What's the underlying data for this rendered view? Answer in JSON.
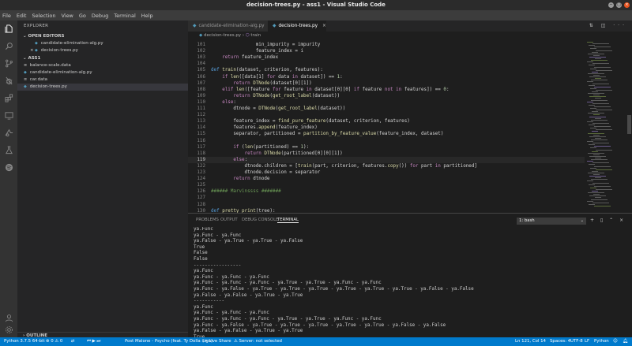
{
  "window": {
    "title": "decision-trees.py - ass1 - Visual Studio Code",
    "controls": [
      "−",
      "□",
      "×"
    ]
  },
  "menu": [
    "File",
    "Edit",
    "Selection",
    "View",
    "Go",
    "Debug",
    "Terminal",
    "Help"
  ],
  "activity_icons": [
    "files-icon",
    "search-icon",
    "source-control-icon",
    "debug-icon",
    "extensions-icon",
    "remote-icon",
    "live-share-icon",
    "test-icon",
    "spotify-icon"
  ],
  "sidebar": {
    "title": "EXPLORER",
    "open_editors_label": "OPEN EDITORS",
    "open_editors": [
      {
        "name": "candidate-elimination-alg.py",
        "close": ""
      },
      {
        "name": "decision-trees.py",
        "close": "×"
      }
    ],
    "folder_label": "ASS1",
    "files": [
      {
        "name": "balance-scale.data",
        "icon": "≡"
      },
      {
        "name": "candidate-elimination-alg.py",
        "icon": "◆"
      },
      {
        "name": "car.data",
        "icon": "≡"
      },
      {
        "name": "decision-trees.py",
        "icon": "◆"
      }
    ],
    "outline_label": "OUTLINE"
  },
  "tabs": [
    {
      "label": "candidate-elimination-alg.py",
      "active": false
    },
    {
      "label": "decision-trees.py",
      "active": true,
      "close": "×"
    }
  ],
  "tab_actions": "⇅ ◫ ···",
  "breadcrumb": [
    "decision-trees.py",
    "train"
  ],
  "code_lines": [
    {
      "n": "101",
      "html": "<span class='tx'>                min_impurity = impurity</span>"
    },
    {
      "n": "102",
      "html": "<span class='tx'>                feature_index = i</span>"
    },
    {
      "n": "103",
      "html": "<span class='tx'>    </span><span class='ct'>return</span><span class='tx'> feature_index</span>"
    },
    {
      "n": "104",
      "html": ""
    },
    {
      "n": "105",
      "html": "<span class='kw'>def</span><span class='tx'> </span><span class='fn'>train</span><span class='tx'>(dataset, criterion, features):</span>"
    },
    {
      "n": "106",
      "html": "<span class='tx'>    </span><span class='ct'>if</span><span class='tx'> </span><span class='fn'>len</span><span class='tx'>([data[1] </span><span class='ct'>for</span><span class='tx'> data </span><span class='ct'>in</span><span class='tx'> dataset]) == </span><span class='nm'>1</span><span class='tx'>:</span>"
    },
    {
      "n": "107",
      "html": "<span class='tx'>        </span><span class='ct'>return</span><span class='tx'> </span><span class='fn'>DTNode</span><span class='tx'>(dataset[0][1])</span>"
    },
    {
      "n": "108",
      "html": "<span class='tx'>    </span><span class='ct'>elif</span><span class='tx'> </span><span class='fn'>len</span><span class='tx'>([feature </span><span class='ct'>for</span><span class='tx'> feature </span><span class='ct'>in</span><span class='tx'> dataset[0][0] </span><span class='ct'>if</span><span class='tx'> feature </span><span class='ct'>not in</span><span class='tx'> features]) == </span><span class='nm'>0</span><span class='tx'>:</span>"
    },
    {
      "n": "109",
      "html": "<span class='tx'>        </span><span class='ct'>return</span><span class='tx'> </span><span class='fn'>DTNode</span><span class='tx'>(</span><span class='fn'>get_root_label</span><span class='tx'>(dataset))</span>"
    },
    {
      "n": "110",
      "html": "<span class='tx'>    </span><span class='ct'>else</span><span class='tx'>:</span>"
    },
    {
      "n": "111",
      "html": "<span class='tx'>        dtnode = </span><span class='fn'>DTNode</span><span class='tx'>(</span><span class='fn'>get_root_label</span><span class='tx'>(dataset))</span>"
    },
    {
      "n": "112",
      "html": ""
    },
    {
      "n": "113",
      "html": "<span class='tx'>        feature_index = </span><span class='fn'>find_pure_feature</span><span class='tx'>(dataset, criterion, features)</span>"
    },
    {
      "n": "114",
      "html": "<span class='tx'>        features.</span><span class='fn'>append</span><span class='tx'>(feature_index)</span>"
    },
    {
      "n": "115",
      "html": "<span class='tx'>        separator, partitioned = </span><span class='fn'>partition_by_feature_value</span><span class='tx'>(feature_index, dataset)</span>"
    },
    {
      "n": "116",
      "html": ""
    },
    {
      "n": "117",
      "html": "<span class='tx'>        </span><span class='ct'>if</span><span class='tx'> (</span><span class='fn'>len</span><span class='tx'>(partitioned) == </span><span class='nm'>1</span><span class='tx'>):</span>"
    },
    {
      "n": "118",
      "html": "<span class='tx'>            </span><span class='ct'>return</span><span class='tx'> </span><span class='fn'>DTNode</span><span class='tx'>(partitioned[0][0][1])</span>"
    },
    {
      "n": "119",
      "html": "<span class='tx'>        </span><span class='ct'>else</span><span class='tx'>:</span>",
      "current": true
    },
    {
      "n": "122",
      "html": "<span class='tx'>            dtnode.children = [</span><span class='fn'>train</span><span class='tx'>(part, criterion, features.</span><span class='fn'>copy</span><span class='tx'>()) </span><span class='ct'>for</span><span class='tx'> part </span><span class='ct'>in</span><span class='tx'> partitioned]</span>"
    },
    {
      "n": "123",
      "html": "<span class='tx'>            dtnode.decision = separator</span>"
    },
    {
      "n": "124",
      "html": "<span class='tx'>        </span><span class='ct'>return</span><span class='tx'> dtnode</span>"
    },
    {
      "n": "125",
      "html": ""
    },
    {
      "n": "126",
      "html": "<span class='cm'>###### Marvinssss #######</span>"
    },
    {
      "n": "127",
      "html": ""
    },
    {
      "n": "128",
      "html": ""
    },
    {
      "n": "130",
      "html": "<span class='kw'>def</span><span class='tx'> </span><span class='fn'>pretty_print</span><span class='tx'>(tree):</span>"
    }
  ],
  "panel": {
    "tabs": [
      "PROBLEMS",
      "OUTPUT",
      "DEBUG CONSOLE",
      "TERMINAL"
    ],
    "active_tab": "TERMINAL",
    "terminal_select": "1: bash",
    "actions": "+ ▯ ⌃ ×"
  },
  "terminal_lines": [
    "ya.Func",
    "ya.Func - ya.Func",
    "ya.False - ya.True - ya.True - ya.False",
    "True",
    "False",
    "False",
    "-----------------",
    "ya.Func",
    "ya.Func - ya.Func - ya.Func",
    "ya.Func - ya.Func - ya.Func - ya.True - ya.True - ya.Func - ya.Func",
    "ya.Func - ya.False - ya.True - ya.True - ya.True - ya.True - ya.True - ya.True - ya.False - ya.False",
    "ya.False - ya.False - ya.True - ya.True",
    "-----------",
    "ya.Func",
    "ya.Func - ya.Func - ya.Func",
    "ya.Func - ya.Func - ya.Func - ya.True - ya.True - ya.Func - ya.Func",
    "ya.Func - ya.False - ya.True - ya.True - ya.True - ya.True - ya.True - ya.False - ya.False",
    "ya.False - ya.False - ya.True - ya.True",
    "True",
    "True",
    "True"
  ],
  "statusbar": {
    "python": "Python 3.7.5 64-bit",
    "problems": "⊗ 0 ⚠ 0",
    "media": "⏮ ▶ ⏭",
    "track": "Post Malone - Psycho (feat. Ty Dolla $ign)",
    "liveshare": "Live Share",
    "server": "Server: not selected",
    "position": "Ln 121, Col 14",
    "spaces": "Spaces: 4",
    "encoding": "UTF-8",
    "eol": "LF",
    "language": "Python",
    "accent_color": "#007acc"
  }
}
